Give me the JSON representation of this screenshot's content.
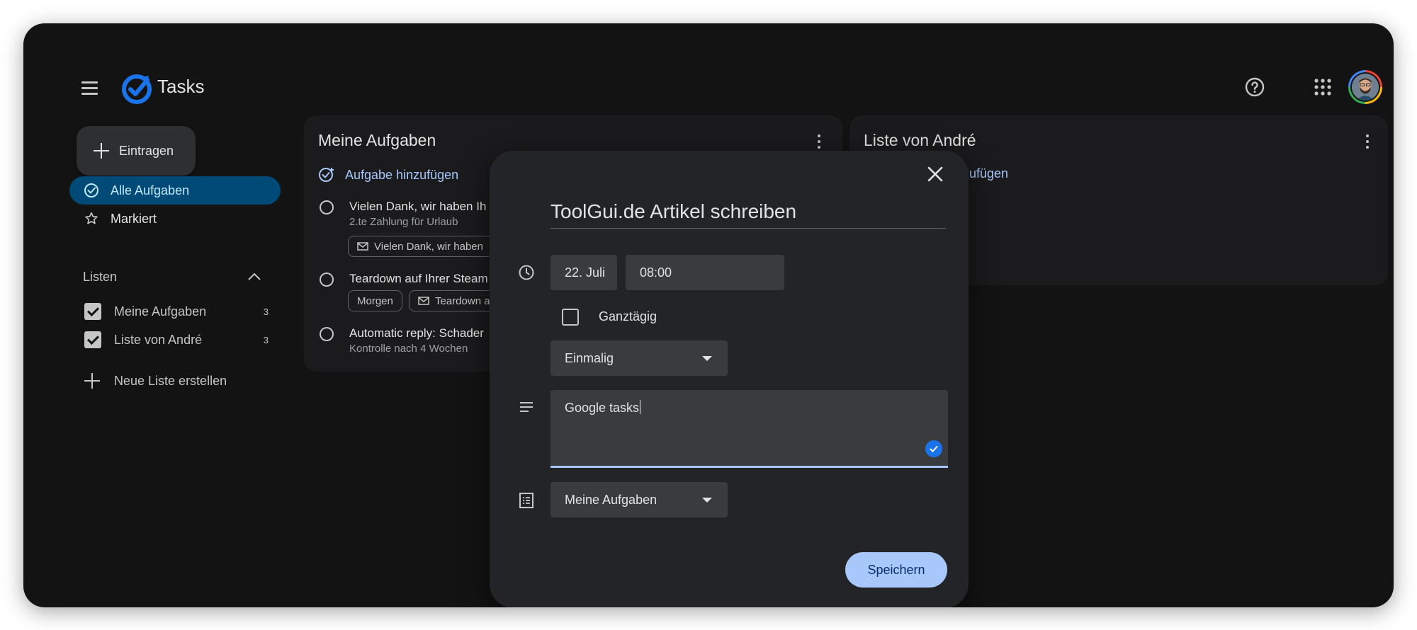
{
  "header": {
    "app_title": "Tasks",
    "icons": [
      "menu-icon",
      "tasks-logo-icon",
      "help-icon",
      "apps-grid-icon",
      "avatar"
    ]
  },
  "sidebar": {
    "create_label": "Eintragen",
    "nav": [
      {
        "label": "Alle Aufgaben",
        "icon": "check-circle-icon",
        "active": true
      },
      {
        "label": "Markiert",
        "icon": "star-icon",
        "active": false
      }
    ],
    "lists_title": "Listen",
    "lists": [
      {
        "label": "Meine Aufgaben",
        "count": "3",
        "checked": true
      },
      {
        "label": "Liste von André",
        "count": "3",
        "checked": true
      }
    ],
    "new_list_label": "Neue Liste erstellen"
  },
  "panels": [
    {
      "title": "Meine Aufgaben",
      "add_task_label": "Aufgabe hinzufügen",
      "tasks": [
        {
          "title": "Vielen Dank, wir haben Ih",
          "subtitle": "2.te Zahlung für Urlaub",
          "chips": [
            {
              "label": "Vielen Dank, wir haben",
              "icon": "mail-icon"
            }
          ]
        },
        {
          "title": "Teardown auf Ihrer Steam",
          "subtitle": "",
          "chips": [
            {
              "label": "Morgen",
              "icon": ""
            },
            {
              "label": "Teardown a",
              "icon": "mail-icon"
            }
          ]
        },
        {
          "title": "Automatic reply: Schader",
          "subtitle": "Kontrolle nach 4 Wochen",
          "chips": []
        }
      ]
    },
    {
      "title": "Liste von André",
      "add_task_label": "zufügen",
      "tasks": []
    }
  ],
  "modal": {
    "title": "ToolGui.de Artikel schreiben",
    "date": "22. Juli",
    "time": "08:00",
    "all_day_label": "Ganztägig",
    "all_day_checked": false,
    "repeat": "Einmalig",
    "description": "Google tasks",
    "list": "Meine Aufgaben",
    "save_label": "Speichern"
  },
  "colors": {
    "background": "#131314",
    "panel": "#1b1b1d",
    "modal": "#232427",
    "accent": "#a8c7fa",
    "active_nav": "#004a77",
    "logo_blue": "#1a73e8"
  }
}
